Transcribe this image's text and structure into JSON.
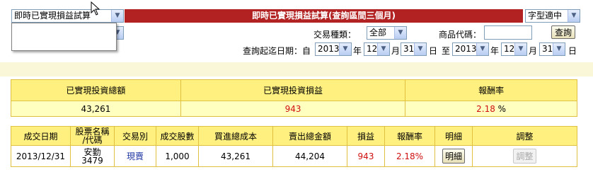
{
  "function_select": {
    "value": "即時已實現損益試算"
  },
  "banner": {
    "title": "即時已實現損益試算(查詢區間三個月)"
  },
  "font_size_select": {
    "value": "字型適中"
  },
  "account_select": {
    "value": ""
  },
  "filter": {
    "trade_type_label": "交易種類：",
    "trade_type_value": "全部",
    "product_code_label": "商品代碼：",
    "product_code_value": "",
    "query_button": "查詢"
  },
  "date_range": {
    "label": "查詢起迄日期：自",
    "start_year": "2013",
    "start_month": "12",
    "start_day": "31",
    "year_unit": "年",
    "month_unit": "月",
    "day_unit": "日",
    "to_label": "至",
    "end_year": "2013",
    "end_month": "12",
    "end_day": "31"
  },
  "summary": {
    "headers": [
      "已實現投資總額",
      "已實現投資損益",
      "報酬率"
    ],
    "total": "43,261",
    "pnl": "943",
    "rate": "2.18",
    "rate_unit": "%"
  },
  "detail": {
    "headers": [
      "成交日期",
      "股票名稱/代碼",
      "交易別",
      "成交股數",
      "買進總成本",
      "賣出總金額",
      "損益",
      "報酬率",
      "明細",
      "調整"
    ],
    "header_stock_line1": "股票名稱",
    "header_stock_line2": "/代碼",
    "rows": [
      {
        "date": "2013/12/31",
        "stock_name": "安勤",
        "stock_code": "3479",
        "trade_type": "現賣",
        "shares": "1,000",
        "buy_cost": "43,261",
        "sell_amount": "44,204",
        "pnl": "943",
        "rate": "2.18%",
        "detail_button": "明細",
        "adjust_button": "調整"
      }
    ]
  },
  "colors": {
    "banner_bg": "#b22222",
    "panel_bg": "#ffffc0",
    "header_bg": "#fff080",
    "border": "#e0c040",
    "stripe_bg": "#faf6d8"
  }
}
